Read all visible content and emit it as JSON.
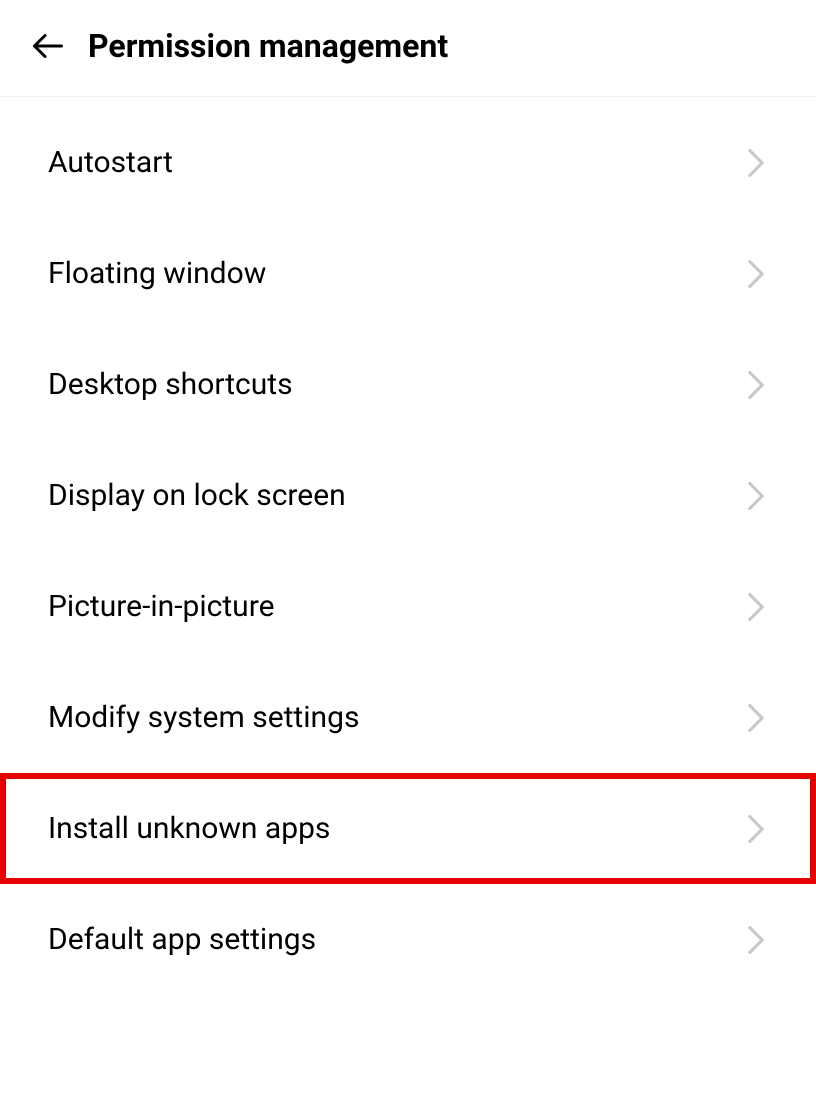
{
  "header": {
    "title": "Permission management"
  },
  "items": [
    {
      "label": "Autostart",
      "highlighted": false
    },
    {
      "label": "Floating window",
      "highlighted": false
    },
    {
      "label": "Desktop shortcuts",
      "highlighted": false
    },
    {
      "label": "Display on lock screen",
      "highlighted": false
    },
    {
      "label": "Picture-in-picture",
      "highlighted": false
    },
    {
      "label": "Modify system settings",
      "highlighted": false
    },
    {
      "label": "Install unknown apps",
      "highlighted": true
    },
    {
      "label": "Default app settings",
      "highlighted": false
    }
  ]
}
